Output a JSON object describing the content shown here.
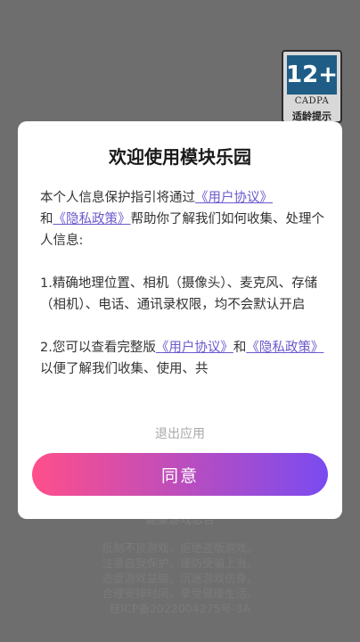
{
  "background": {
    "age_rating": {
      "number": "12+",
      "org": "CADPA",
      "caption": "适龄提示"
    },
    "partial_text": "健康游戏忠告",
    "health_notice": [
      "抵制不良游戏，拒绝盗版游戏。",
      "注意自我保护，谨防受骗上当。",
      "适度游戏益脑，沉迷游戏伤身。",
      "合理安排时间，享受健康生活。",
      "桂ICP备2022004275号-3A"
    ]
  },
  "dialog": {
    "title": "欢迎使用模块乐园",
    "p1": {
      "t1": "本个人信息保护指引将通过",
      "link1": "《用户协议》",
      "t2": "和",
      "link2": "《隐私政策》",
      "t3": "帮助你了解我们如何收集、处理个人信息:"
    },
    "p2": "1.精确地理位置、相机（摄像头）、麦克风、存储（相机）、电话、通讯录权限，均不会默认开启",
    "p3": {
      "t1": "2.您可以查看完整版",
      "link1": "《用户协议》",
      "t2": "和",
      "link2": "《隐私政策》",
      "t3": "以便了解我们收集、使用、共"
    },
    "exit_label": "退出应用",
    "agree_label": "同意"
  },
  "colors": {
    "overlay": "#6e6e6e",
    "link": "#6a5acd",
    "button_gradient_start": "#ff4f8a",
    "button_gradient_end": "#7a4bf0"
  }
}
